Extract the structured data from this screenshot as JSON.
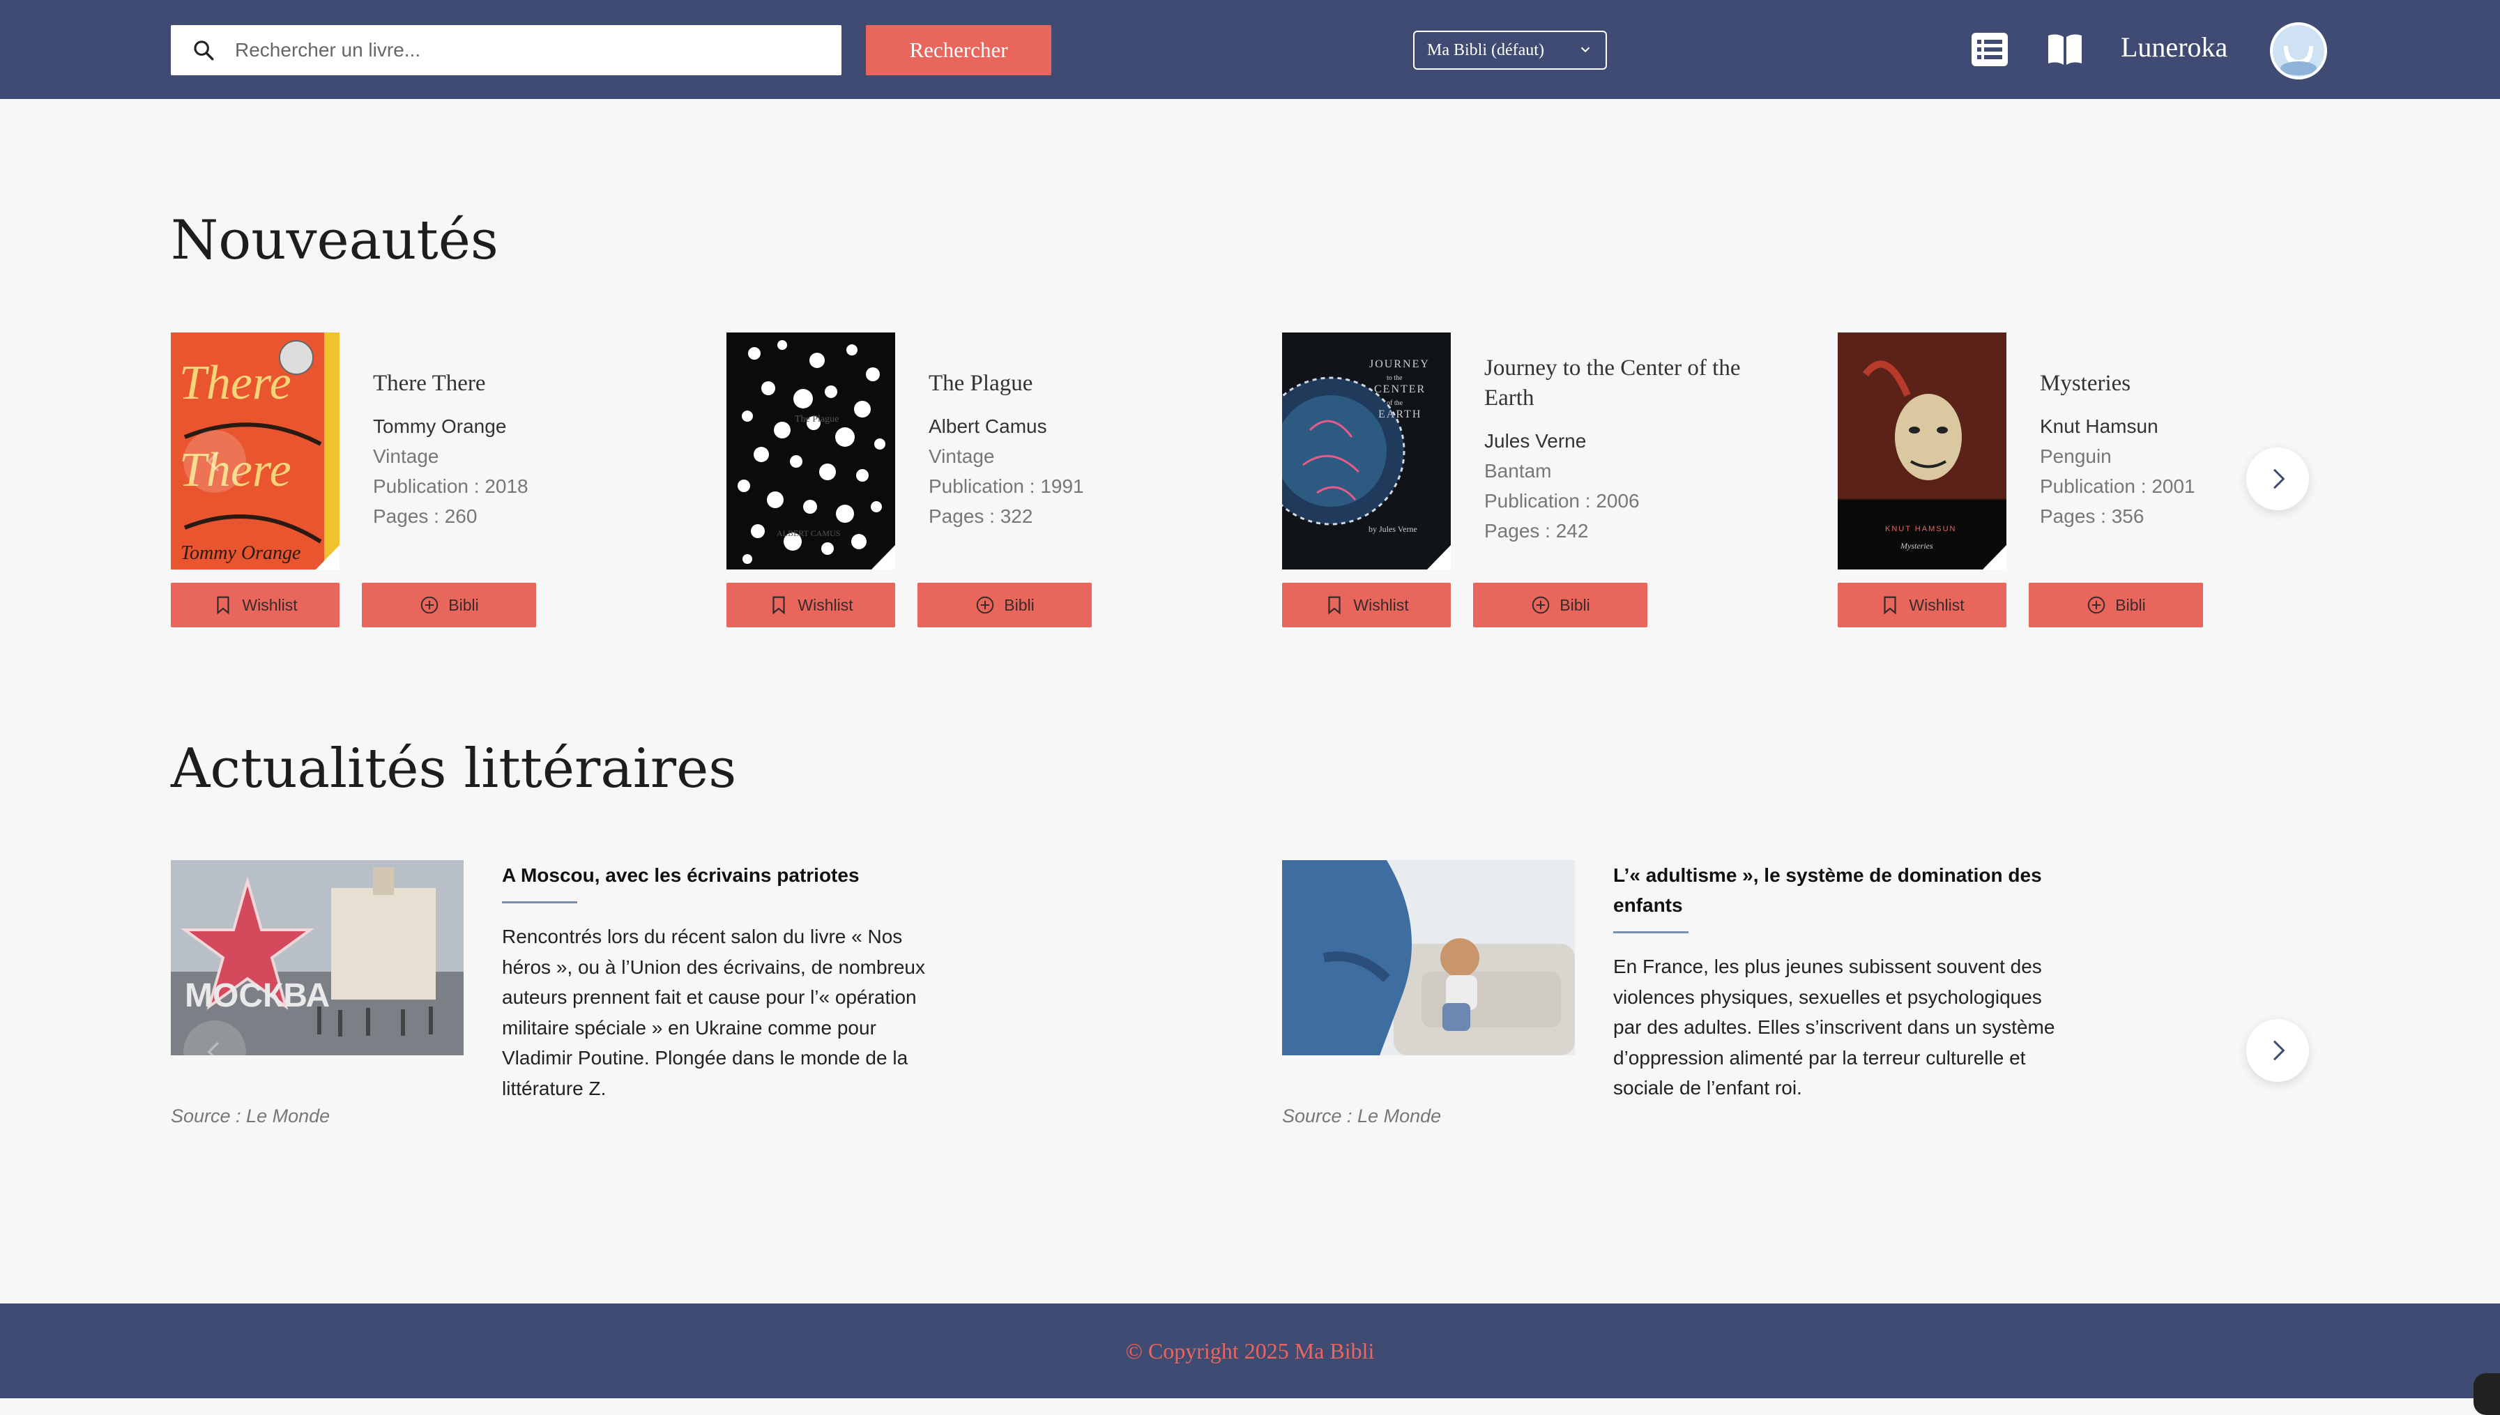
{
  "header": {
    "search_placeholder": "Rechercher un livre...",
    "search_button": "Rechercher",
    "library_select": "Ma Bibli (défaut)",
    "username": "Luneroka",
    "icons": [
      "search-icon",
      "list-icon",
      "open-book-icon",
      "avatar"
    ]
  },
  "new_releases": {
    "title": "Nouveautés",
    "books": [
      {
        "title": "There There",
        "author": "Tommy Orange",
        "publisher": "Vintage",
        "publication": "Publication : 2018",
        "pages": "Pages : 260",
        "wishlist": "Wishlist",
        "bibli": "Bibli",
        "cover_text": "There There",
        "cover_author": "Tommy Orange"
      },
      {
        "title": "The Plague",
        "author": "Albert Camus",
        "publisher": "Vintage",
        "publication": "Publication : 1991",
        "pages": "Pages : 322",
        "wishlist": "Wishlist",
        "bibli": "Bibli",
        "cover_text": "The Plague",
        "cover_author": "ALBERT CAMUS"
      },
      {
        "title": "Journey to the Center of the Earth",
        "author": "Jules Verne",
        "publisher": "Bantam",
        "publication": "Publication : 2006",
        "pages": "Pages : 242",
        "wishlist": "Wishlist",
        "bibli": "Bibli",
        "cover_text": "JOURNEY to the CENTER of the EARTH",
        "cover_author": "by Jules Verne"
      },
      {
        "title": "Mysteries",
        "author": "Knut Hamsun",
        "publisher": "Penguin",
        "publication": "Publication : 2001",
        "pages": "Pages : 356",
        "wishlist": "Wishlist",
        "bibli": "Bibli",
        "cover_text": "Mysteries",
        "cover_author": "KNUT HAMSUN"
      }
    ]
  },
  "news": {
    "title": "Actualités littéraires",
    "items": [
      {
        "title": "A Moscou, avec les écrivains patriotes",
        "description": "Rencontrés lors du récent salon du livre « Nos héros », ou à l’Union des écrivains, de nombreux auteurs prennent fait et cause pour l’« opération militaire spéciale » en Ukraine comme pour Vladimir Poutine. Plongée dans le monde de la littérature Z.",
        "source": "Source : Le Monde",
        "img_text": "МОСКВА"
      },
      {
        "title": "L’« adultisme », le système de domination des enfants",
        "description": "En France, les plus jeunes subissent souvent des violences physiques, sexuelles et psychologiques par des adultes. Elles s’inscrivent dans un système d’oppression alimenté par la terreur culturelle et sociale de l’enfant roi.",
        "source": "Source : Le Monde"
      }
    ]
  },
  "footer": {
    "copyright": "© Copyright 2025 Ma Bibli"
  },
  "colors": {
    "navbar": "#3f4b72",
    "accent": "#e8665c",
    "background": "#f7f7f7"
  }
}
